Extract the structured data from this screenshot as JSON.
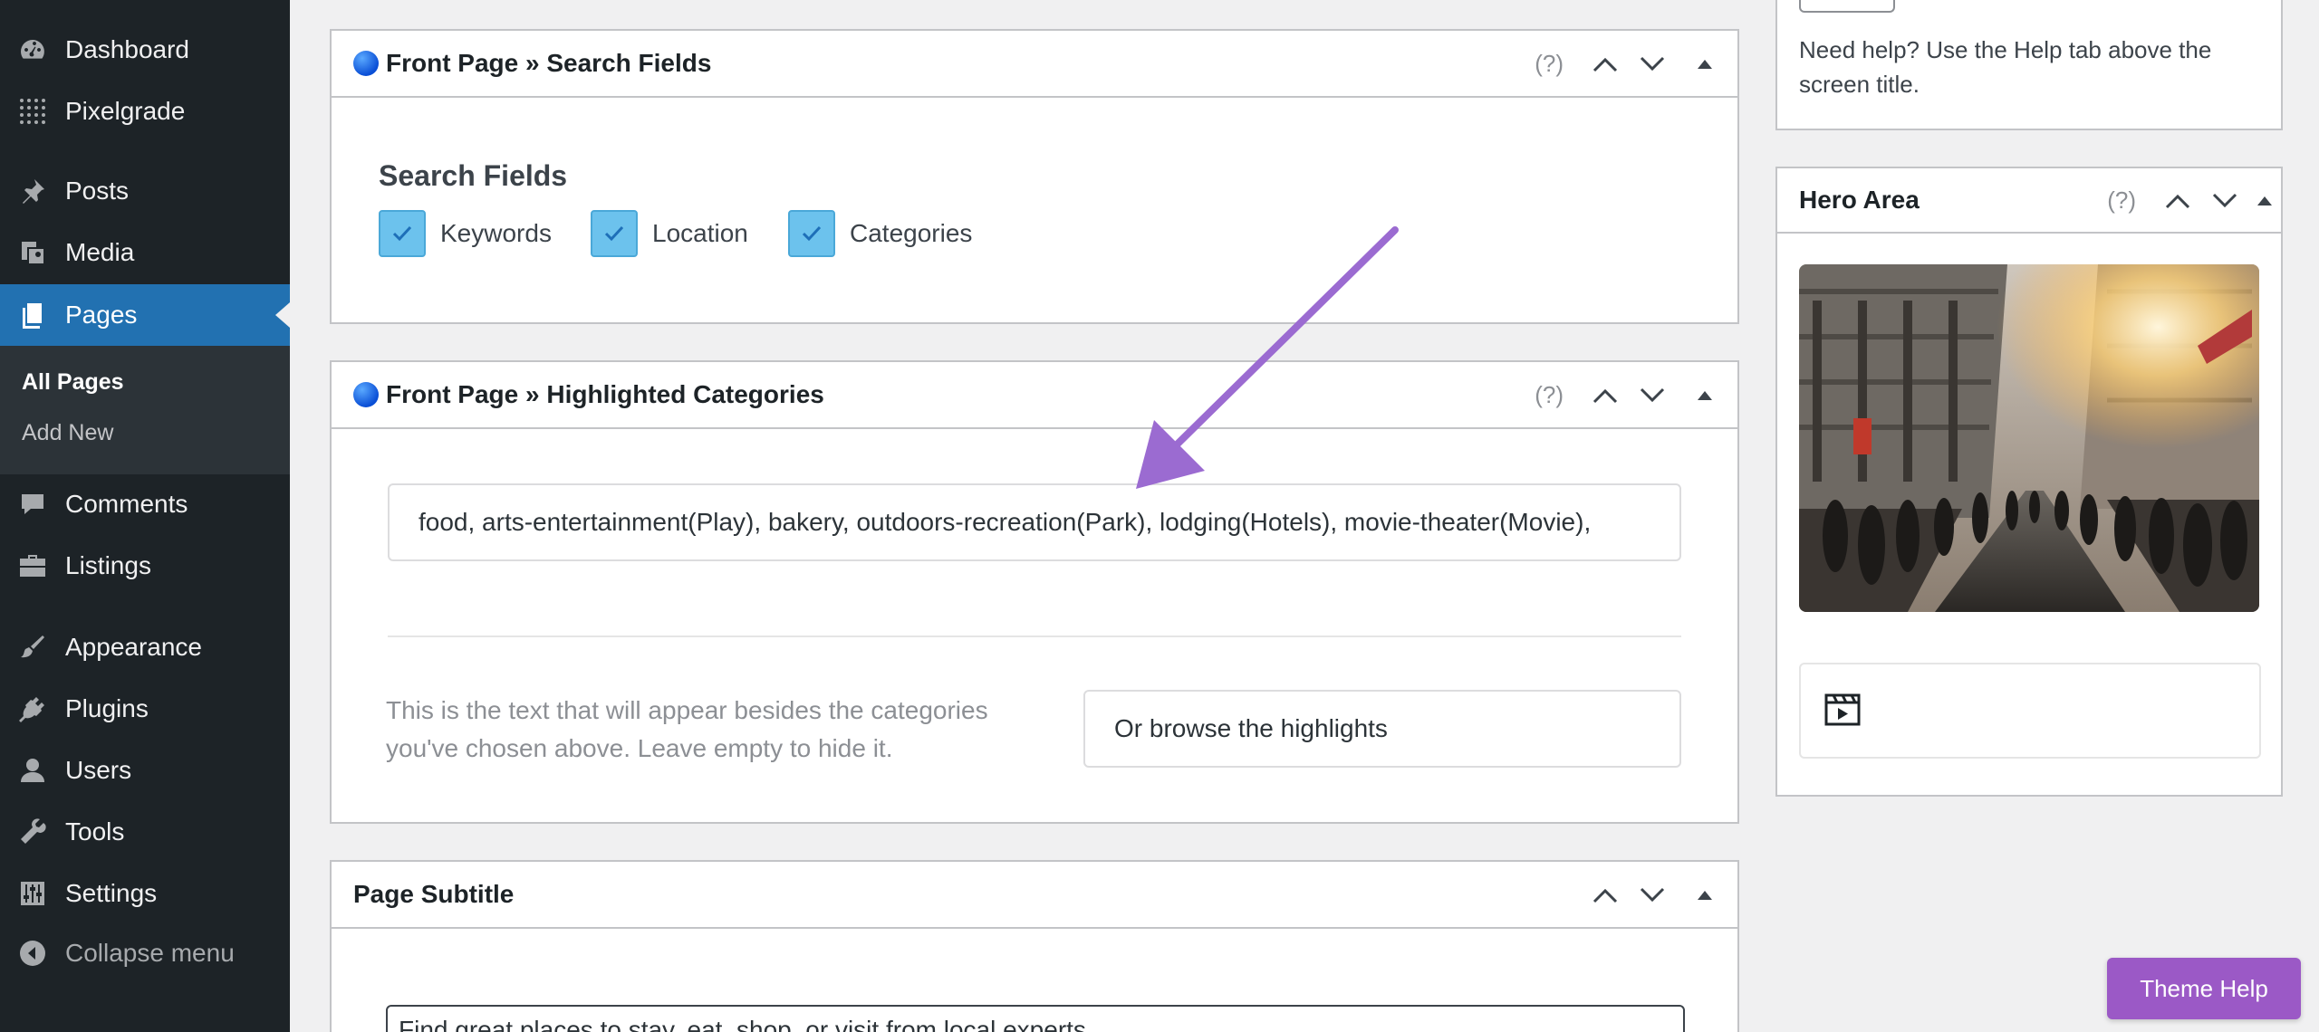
{
  "sidebar": {
    "items": [
      {
        "label": "Dashboard",
        "icon": "dashboard-icon"
      },
      {
        "label": "Pixelgrade",
        "icon": "grid-icon"
      },
      {
        "label": "Posts",
        "icon": "pin-icon"
      },
      {
        "label": "Media",
        "icon": "media-icon"
      },
      {
        "label": "Pages",
        "icon": "pages-icon"
      },
      {
        "label": "Comments",
        "icon": "comment-icon"
      },
      {
        "label": "Listings",
        "icon": "briefcase-icon"
      },
      {
        "label": "Appearance",
        "icon": "brush-icon"
      },
      {
        "label": "Plugins",
        "icon": "plug-icon"
      },
      {
        "label": "Users",
        "icon": "user-icon"
      },
      {
        "label": "Tools",
        "icon": "wrench-icon"
      },
      {
        "label": "Settings",
        "icon": "sliders-icon"
      }
    ],
    "submenu": [
      "All Pages",
      "Add New"
    ],
    "collapse_label": "Collapse menu"
  },
  "search_fields_box": {
    "title": "Front Page » Search Fields",
    "help": "(?)",
    "section_label": "Search Fields",
    "checkboxes": [
      {
        "label": "Keywords",
        "checked": true
      },
      {
        "label": "Location",
        "checked": true
      },
      {
        "label": "Categories",
        "checked": true
      }
    ]
  },
  "highlighted_box": {
    "title": "Front Page » Highlighted Categories",
    "help": "(?)",
    "categories_value": "food, arts-entertainment(Play), bakery, outdoors-recreation(Park), lodging(Hotels), movie-theater(Movie),",
    "description": "This is the text that will appear besides the categories you've chosen above. Leave empty to hide it.",
    "browse_value": "Or browse the highlights"
  },
  "subtitle_box": {
    "title": "Page Subtitle",
    "value": "Find great places to stay, eat, shop, or visit from local experts."
  },
  "right_column": {
    "help_note": "Need help? Use the Help tab above the screen title.",
    "hero_title": "Hero Area",
    "hero_help": "(?)",
    "video_icon": "video-icon"
  },
  "theme_help_label": "Theme Help",
  "colors": {
    "accent": "#2271b1",
    "sidebar": "#1d2327",
    "arrow": "#9b6bd1",
    "theme_help": "#9b59c6"
  }
}
